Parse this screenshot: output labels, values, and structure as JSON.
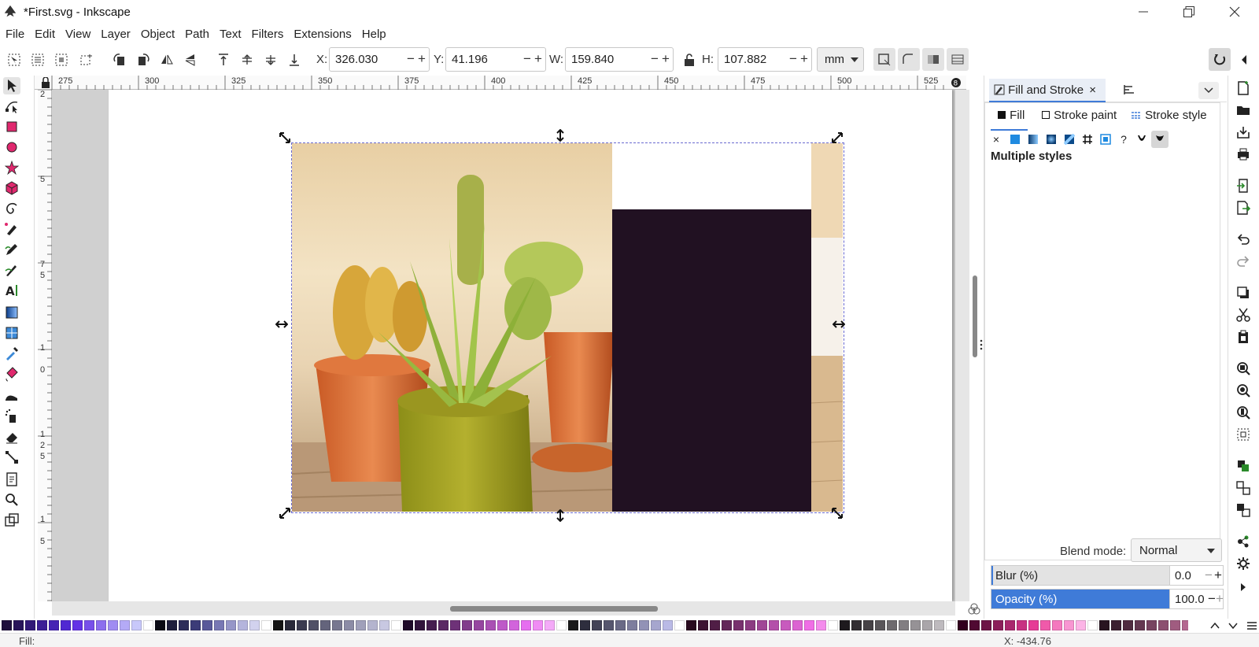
{
  "window": {
    "title": "*First.svg - Inkscape",
    "minimize_icon": "minimize-icon",
    "maximize_icon": "restore-icon",
    "close_icon": "close-icon"
  },
  "menu": [
    "File",
    "Edit",
    "View",
    "Layer",
    "Object",
    "Path",
    "Text",
    "Filters",
    "Extensions",
    "Help"
  ],
  "tool_controls": {
    "x_label": "X:",
    "x_value": "326.030",
    "y_label": "Y:",
    "y_value": "41.196",
    "w_label": "W:",
    "w_value": "159.840",
    "h_label": "H:",
    "h_value": "107.882",
    "unit": "mm",
    "minus": "−",
    "plus": "+"
  },
  "rulers": {
    "horizontal": [
      "275",
      "300",
      "325",
      "350",
      "375",
      "400",
      "425",
      "450",
      "475",
      "500",
      "525"
    ],
    "vertical": [
      "2",
      "5",
      "7",
      "5",
      "1",
      "0",
      "1",
      "2",
      "5",
      "1",
      "5"
    ]
  },
  "dock": {
    "tab_fill_stroke": "Fill and Stroke",
    "tab_close": "×",
    "fill_tab": "Fill",
    "stroke_paint_tab": "Stroke paint",
    "stroke_style_tab": "Stroke style",
    "multiple_styles": "Multiple styles",
    "blend_mode_label": "Blend mode:",
    "blend_mode_value": "Normal",
    "blur_label": "Blur (%)",
    "blur_value": "0.0",
    "opacity_label": "Opacity (%)",
    "opacity_value": "100.0",
    "paint_none": "×",
    "paint_unknown": "?"
  },
  "statusbar": {
    "fill_label": "Fill:",
    "cursor_x": "X: -434.76"
  },
  "colors": {
    "rect_fill": "#211122",
    "accent": "#3f7bd8",
    "opacity_fill": "#3f7bd8"
  },
  "palette": [
    "#1e0f3c",
    "#28145a",
    "#321978",
    "#3c1e96",
    "#4623b4",
    "#5028d2",
    "#6432e6",
    "#7850ea",
    "#8c6eee",
    "#a08cf2",
    "#b4aaf6",
    "#c8c8fa",
    "#ffffff",
    "#0a0a14",
    "#1e1e3c",
    "#2d2d5a",
    "#3c3c78",
    "#5a5a9a",
    "#7878b4",
    "#9696c8",
    "#b4b4dc",
    "#d2d2ee",
    "#ffffff",
    "#141414",
    "#2a2a3a",
    "#3c3c50",
    "#505066",
    "#64647c",
    "#787890",
    "#8c8ca6",
    "#a0a0ba",
    "#b4b4ce",
    "#c8c8e2",
    "#ffffff",
    "#1e0a28",
    "#32143c",
    "#461e50",
    "#5a2864",
    "#6e3278",
    "#823c8c",
    "#9646a0",
    "#aa50b4",
    "#be5ac8",
    "#d264dc",
    "#e66ef0",
    "#f08cf4",
    "#f4aaf8",
    "#ffffff",
    "#1a1a1a",
    "#2e2e3e",
    "#424256",
    "#56566e",
    "#6a6a86",
    "#7e7e9e",
    "#9292b6",
    "#a6a6ce",
    "#babae6",
    "#ffffff",
    "#280a1e",
    "#3c1432",
    "#501e46",
    "#64285a",
    "#78326e",
    "#8c3c82",
    "#a04696",
    "#b450aa",
    "#c85abe",
    "#dc64d2",
    "#f06ee6",
    "#f48cec",
    "#ffffff",
    "#1e1a1e",
    "#322e32",
    "#464246",
    "#5a565a",
    "#6e6a6e",
    "#827e82",
    "#969296",
    "#aaa6aa",
    "#bebabe",
    "#ffffff",
    "#32001e",
    "#500a32",
    "#6e1446",
    "#8c1e5a",
    "#aa286e",
    "#c83282",
    "#e63c96",
    "#f05aaa",
    "#f478be",
    "#f896d2",
    "#fcb4e6",
    "#ffffff",
    "#281420",
    "#3c2030",
    "#502c40",
    "#643850",
    "#784460",
    "#8c5070",
    "#a05c80",
    "#b46890",
    "#c874a0",
    "#ffffff",
    "#3c0014",
    "#5a0a1e",
    "#781428",
    "#961e32",
    "#b4283c",
    "#d23246",
    "#f03c50",
    "#f45a6e",
    "#f8788c",
    "#fc96aa",
    "#ffffff",
    "#2a1a1a",
    "#3e2a2a",
    "#523a3a",
    "#664a4a",
    "#7a5a5a",
    "#8e6a6a",
    "#a27a7a",
    "#b68a8a",
    "#ffffff"
  ]
}
